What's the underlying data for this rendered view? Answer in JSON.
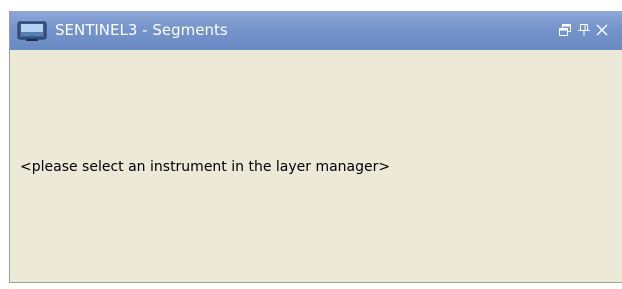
{
  "panel": {
    "title": "SENTINEL3 - Segments",
    "icons": {
      "app": "monitor-icon",
      "restore": "restore-window-icon",
      "pin": "pin-icon",
      "close": "close-icon"
    },
    "message": "<please select an instrument in the layer manager>"
  },
  "colors": {
    "titlebar": "#7694cc",
    "background": "#ece9d8"
  }
}
